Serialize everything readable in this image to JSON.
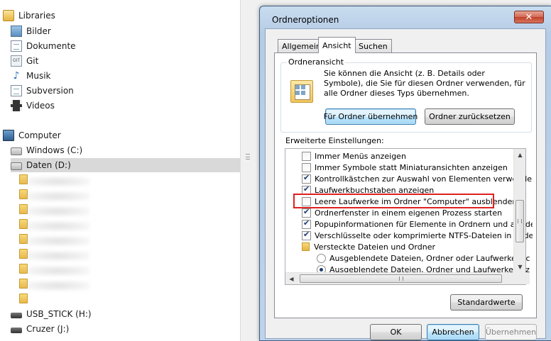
{
  "nav": {
    "libraries": "Libraries",
    "library_items": [
      "Bilder",
      "Dokumente",
      "Git",
      "Musik",
      "Subversion",
      "Videos"
    ],
    "computer": "Computer",
    "drives": [
      "Windows (C:)",
      "Daten (D:)"
    ],
    "removable": [
      "USB_STICK (H:)",
      "Cruzer (J:)"
    ]
  },
  "dialog": {
    "title": "Ordneroptionen",
    "close_glyph": "✕",
    "tabs": [
      "Allgemein",
      "Ansicht",
      "Suchen"
    ],
    "active_tab": "Ansicht",
    "group_title": "Ordneransicht",
    "group_desc": "Sie können die Ansicht (z. B. Details oder Symbole), die Sie für diesen Ordner verwenden, für alle Ordner dieses Typs übernehmen.",
    "apply_button": "Für Ordner übernehmen",
    "reset_button": "Ordner zurücksetzen",
    "advanced_label": "Erweiterte Einstellungen:",
    "settings": [
      {
        "label": "Immer Menüs anzeigen",
        "type": "checkbox",
        "checked": false
      },
      {
        "label": "Immer Symbole statt Miniaturansichten anzeigen",
        "type": "checkbox",
        "checked": false
      },
      {
        "label": "Kontrollkästchen zur Auswahl von Elementen verwenden",
        "type": "checkbox",
        "checked": true
      },
      {
        "label": "Laufwerkbuchstaben anzeigen",
        "type": "checkbox",
        "checked": true
      },
      {
        "label": "Leere Laufwerke im Ordner \"Computer\" ausblenden",
        "type": "checkbox",
        "checked": false
      },
      {
        "label": "Ordnerfenster in einem eigenen Prozess starten",
        "type": "checkbox",
        "checked": true
      },
      {
        "label": "Popupinformationen für Elemente in Ordnern und auf dem D",
        "type": "checkbox",
        "checked": true
      },
      {
        "label": "Verschlüsselte oder komprimierte NTFS-Dateien in anderer",
        "type": "checkbox",
        "checked": true
      },
      {
        "label": "Versteckte Dateien und Ordner",
        "type": "folder",
        "checked": false
      },
      {
        "label": "Ausgeblendete Dateien, Ordner oder Laufwerke nicht a",
        "type": "radio",
        "checked": false
      },
      {
        "label": "Ausgeblendete Dateien, Ordner und Laufwerke anzeig",
        "type": "radio",
        "checked": true
      }
    ],
    "defaults_button": "Standardwerte",
    "ok_button": "OK",
    "cancel_button": "Abbrechen",
    "apply_disabled_button": "Übernehmen"
  },
  "colors": {
    "highlight": "#e02020",
    "dialog_frame": "#bfd3ea"
  }
}
